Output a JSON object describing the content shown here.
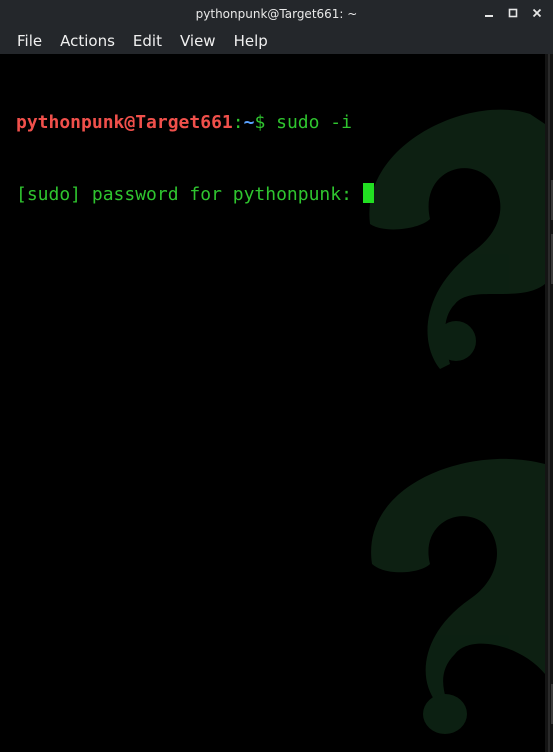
{
  "window": {
    "title": "pythonpunk@Target661: ~"
  },
  "menu": {
    "items": [
      "File",
      "Actions",
      "Edit",
      "View",
      "Help"
    ]
  },
  "terminal": {
    "prompt_user_host": "pythonpunk@Target661",
    "prompt_colon": ":",
    "prompt_path": "~",
    "prompt_dollar": "$",
    "command": " sudo -i",
    "password_prompt": "[sudo] password for pythonpunk: "
  },
  "colors": {
    "background": "#000000",
    "titlebar": "#24272b",
    "prompt_user": "#f0504b",
    "prompt_path": "#5aa2ff",
    "text_green": "#2fc52f",
    "cursor": "#22e022"
  },
  "icons": {
    "minimize": "minimize-icon",
    "maximize": "maximize-icon",
    "close": "close-icon",
    "wallpaper": "question-mark-watermark"
  }
}
